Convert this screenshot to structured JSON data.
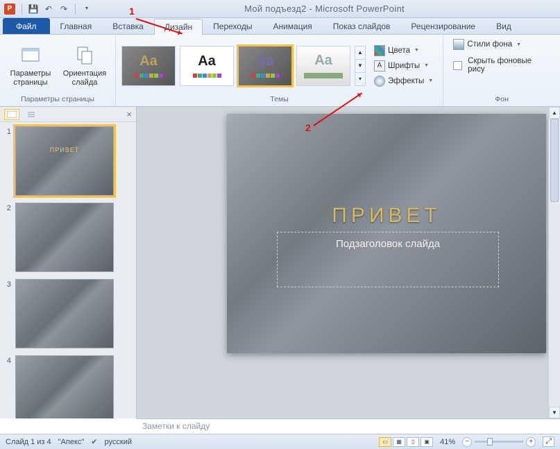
{
  "titlebar": {
    "app_letter": "P",
    "doc_title": "Мой подъезд2",
    "app_name": "Microsoft PowerPoint"
  },
  "tabs": {
    "file": "Файл",
    "home": "Главная",
    "insert": "Вставка",
    "design": "Дизайн",
    "transitions": "Переходы",
    "animation": "Анимация",
    "slideshow": "Показ слайдов",
    "review": "Рецензирование",
    "view": "Вид"
  },
  "ribbon": {
    "page_setup": {
      "page_params": "Параметры страницы",
      "orientation": "Ориентация слайда",
      "group": "Параметры страницы"
    },
    "themes": {
      "group": "Темы",
      "aa": "Aa"
    },
    "variants": {
      "colors": "Цвета",
      "fonts": "Шрифты",
      "effects": "Эффекты"
    },
    "background": {
      "styles": "Стили фона",
      "hide_bg": "Скрыть фоновые рису",
      "group": "Фон"
    }
  },
  "thumbs": {
    "items": [
      {
        "n": "1",
        "title": "ПРИВЕТ"
      },
      {
        "n": "2",
        "title": ""
      },
      {
        "n": "3",
        "title": ""
      },
      {
        "n": "4",
        "title": ""
      }
    ]
  },
  "slide": {
    "title": "ПРИВЕТ",
    "subtitle": "Подзаголовок слайда"
  },
  "notes": {
    "placeholder": "Заметки к слайду"
  },
  "status": {
    "slide_info": "Слайд 1 из 4",
    "theme": "\"Апекс\"",
    "lang": "русский",
    "zoom": "41%"
  },
  "annot": {
    "one": "1",
    "two": "2"
  }
}
